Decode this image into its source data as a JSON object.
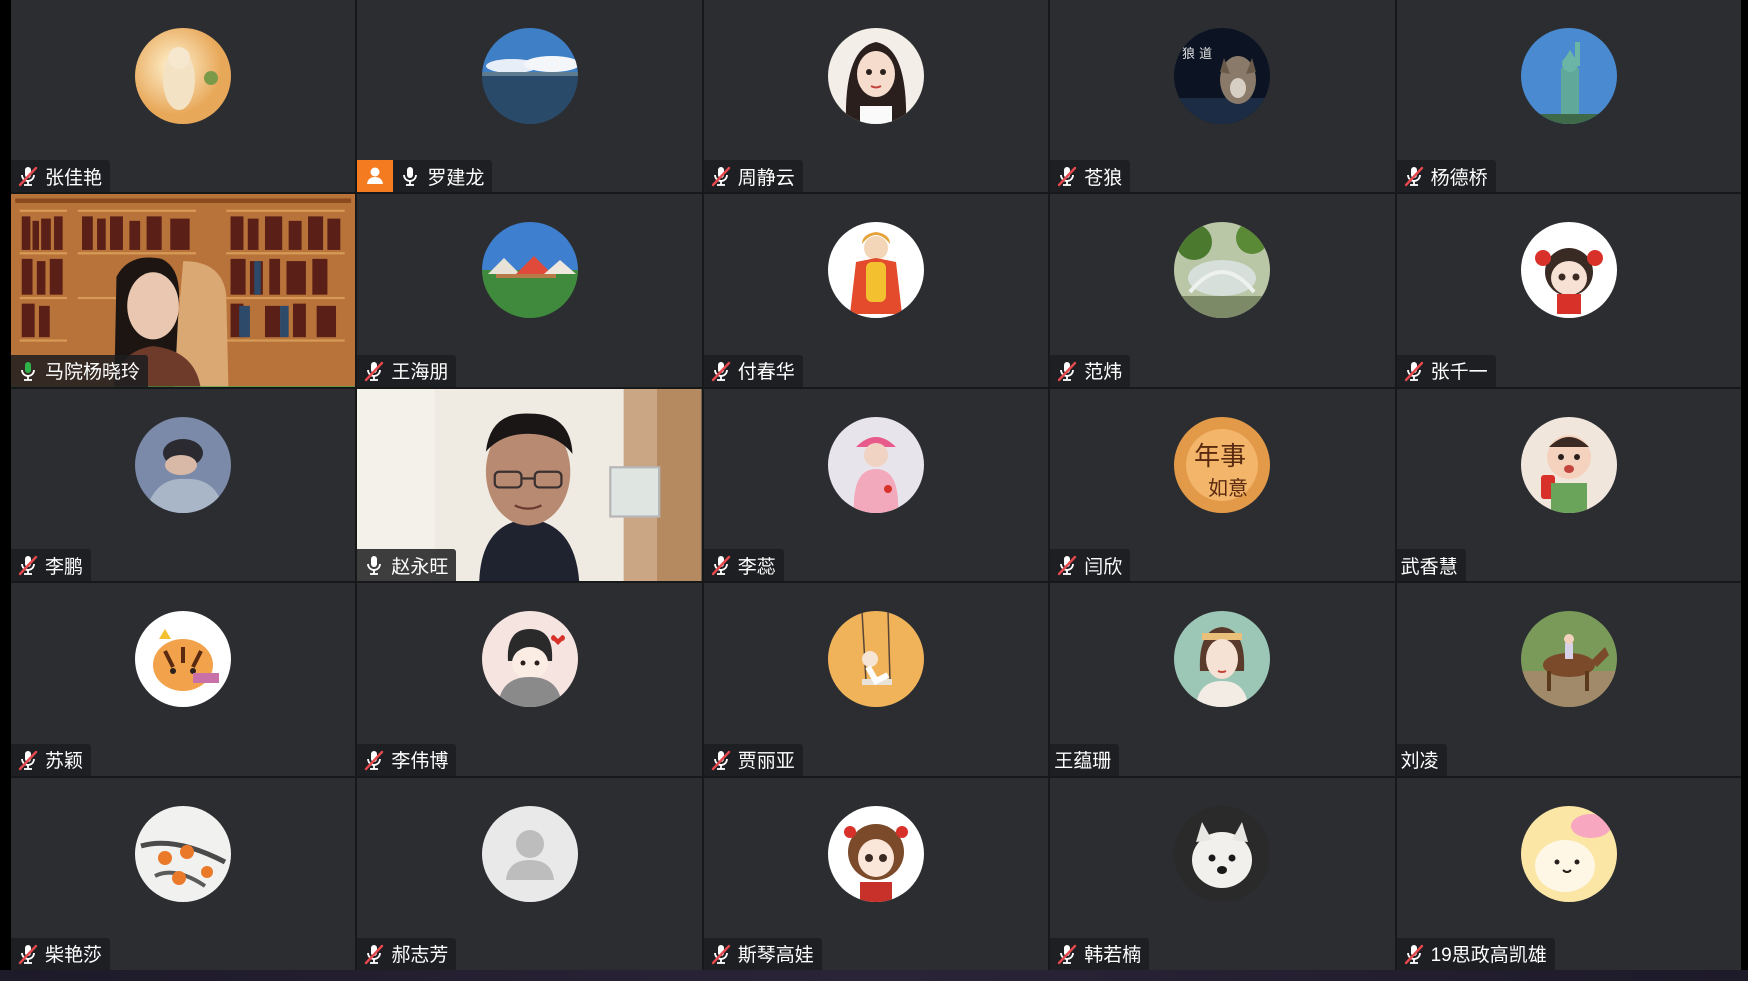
{
  "meeting": {
    "participants": [
      {
        "name": "张佳艳",
        "mic": "muted",
        "avatar": "sunlit-woman-photo"
      },
      {
        "name": "罗建龙",
        "mic": "on",
        "avatar": "lake-sky-photo",
        "host_badge": "host-person-icon"
      },
      {
        "name": "周静云",
        "mic": "muted",
        "avatar": "cartoon-girl-portrait"
      },
      {
        "name": "苍狼",
        "mic": "muted",
        "avatar": "wolf-night-photo"
      },
      {
        "name": "杨德桥",
        "mic": "muted",
        "avatar": "statue-of-liberty-photo"
      },
      {
        "name": "马院杨晓玲",
        "mic": "speaking",
        "video": "bookshelf-woman-video",
        "active_speaker": true
      },
      {
        "name": "王海朋",
        "mic": "muted",
        "avatar": "tents-lawn-photo"
      },
      {
        "name": "付春华",
        "mic": "muted",
        "avatar": "cartoon-girl-cape"
      },
      {
        "name": "范炜",
        "mic": "muted",
        "avatar": "fountain-trees-photo"
      },
      {
        "name": "张千一",
        "mic": "muted",
        "avatar": "cartoon-girl-red-bows"
      },
      {
        "name": "李鹏",
        "mic": "muted",
        "avatar": "sleeping-man-photo"
      },
      {
        "name": "赵永旺",
        "mic": "on",
        "video": "man-glasses-video"
      },
      {
        "name": "李蕊",
        "mic": "muted",
        "avatar": "girl-pink-hat-photo"
      },
      {
        "name": "闫欣",
        "mic": "muted",
        "avatar": "calligraphy-orange-circle"
      },
      {
        "name": "武香慧",
        "mic": "none",
        "avatar": "toddler-drink-photo"
      },
      {
        "name": "苏颖",
        "mic": "muted",
        "avatar": "cartoon-tiger"
      },
      {
        "name": "李伟博",
        "mic": "muted",
        "avatar": "cartoon-boy-hands"
      },
      {
        "name": "贾丽亚",
        "mic": "muted",
        "avatar": "girl-swing-illustration"
      },
      {
        "name": "王蕴珊",
        "mic": "none",
        "avatar": "woman-headband-illustration"
      },
      {
        "name": "刘凌",
        "mic": "none",
        "avatar": "horse-rider-photo"
      },
      {
        "name": "柴艳莎",
        "mic": "muted",
        "avatar": "persimmon-branch-painting"
      },
      {
        "name": "郝志芳",
        "mic": "muted",
        "avatar": "default-person-icon"
      },
      {
        "name": "斯琴高娃",
        "mic": "muted",
        "avatar": "cartoon-girl-curly"
      },
      {
        "name": "韩若楠",
        "mic": "muted",
        "avatar": "white-dog-photo"
      },
      {
        "name": "19思政高凯雄",
        "mic": "muted",
        "avatar": "cartoon-chick"
      }
    ]
  },
  "colors": {
    "tile_bg": "#2b2d31",
    "active_border": "#2fb24a",
    "muted_mic": "#e5484d",
    "mic_white": "#ffffff",
    "host_badge": "#f47b20"
  }
}
